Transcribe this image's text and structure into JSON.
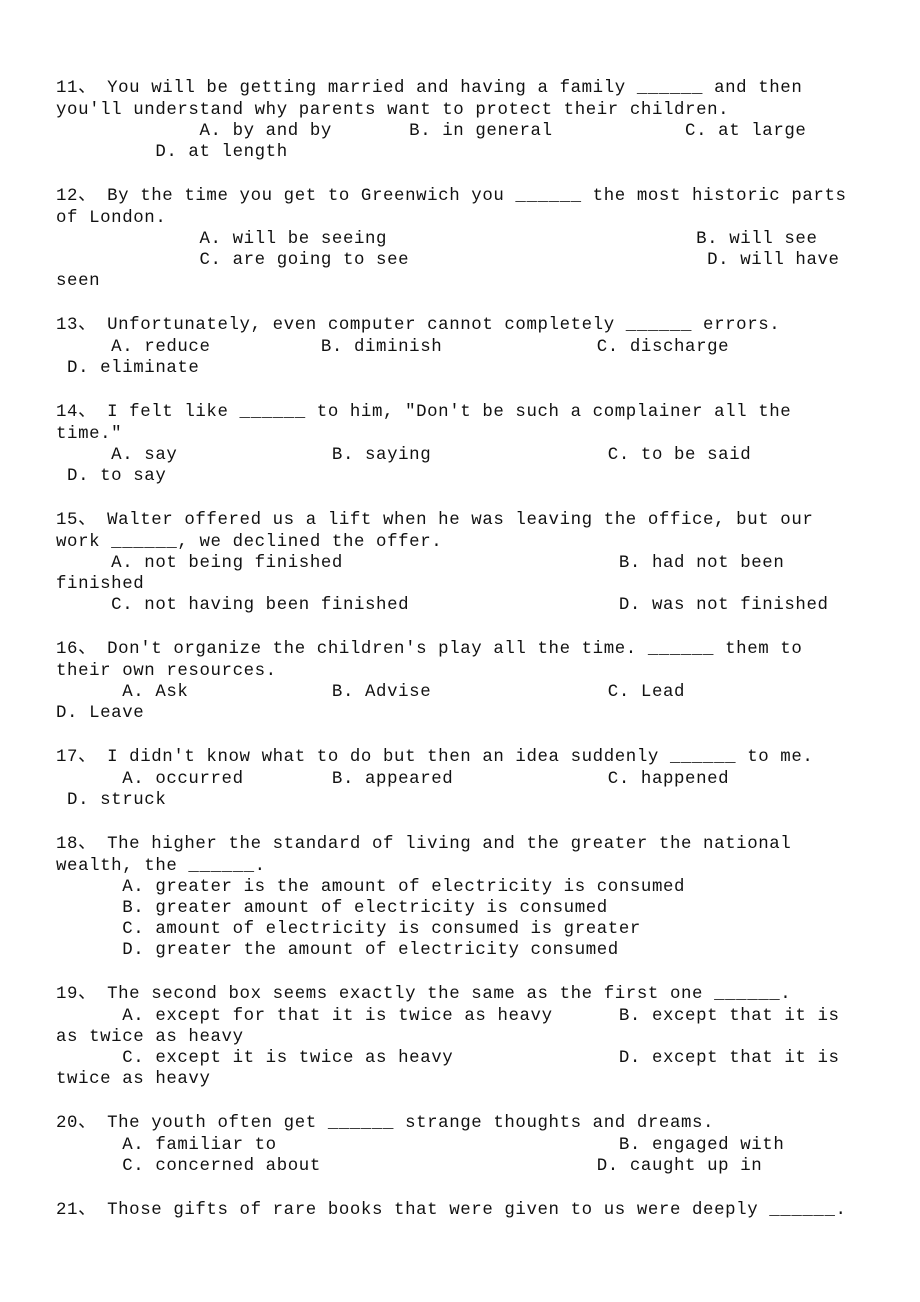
{
  "document": {
    "questions": [
      {
        "number": "11、",
        "stem_lines": [
          "11、 You will be getting married and having a family ______ and then",
          "you'll understand why parents want to protect their children."
        ],
        "option_lines": [
          "             A. by and by       B. in general            C. at large",
          "         D. at length"
        ],
        "options": {
          "A": "by and by",
          "B": "in general",
          "C": "at large",
          "D": "at length"
        }
      },
      {
        "number": "12、",
        "stem_lines": [
          "12、 By the time you get to Greenwich you ______ the most historic parts",
          "of London."
        ],
        "option_lines": [
          "             A. will be seeing                            B. will see",
          "             C. are going to see                           D. will have",
          "seen"
        ],
        "options": {
          "A": "will be seeing",
          "B": "will see",
          "C": "are going to see",
          "D": "will have seen"
        }
      },
      {
        "number": "13、",
        "stem_lines": [
          "13、 Unfortunately, even computer cannot completely ______ errors."
        ],
        "option_lines": [
          "     A. reduce          B. diminish              C. discharge",
          " D. eliminate"
        ],
        "options": {
          "A": "reduce",
          "B": "diminish",
          "C": "discharge",
          "D": "eliminate"
        }
      },
      {
        "number": "14、",
        "stem_lines": [
          "14、 I felt like ______ to him, \"Don't be such a complainer all the",
          "time.\""
        ],
        "option_lines": [
          "     A. say              B. saying                C. to be said",
          " D. to say"
        ],
        "options": {
          "A": "say",
          "B": "saying",
          "C": "to be said",
          "D": "to say"
        }
      },
      {
        "number": "15、",
        "stem_lines": [
          "15、 Walter offered us a lift when he was leaving the office, but our",
          "work ______, we declined the offer."
        ],
        "option_lines": [
          "     A. not being finished                         B. had not been",
          "finished",
          "     C. not having been finished                   D. was not finished"
        ],
        "options": {
          "A": "not being finished",
          "B": "had not been finished",
          "C": "not having been finished",
          "D": "was not finished"
        }
      },
      {
        "number": "16、",
        "stem_lines": [
          "16、 Don't organize the children's play all the time. ______ them to",
          "their own resources."
        ],
        "option_lines": [
          "      A. Ask             B. Advise                C. Lead",
          "D. Leave"
        ],
        "options": {
          "A": "Ask",
          "B": "Advise",
          "C": "Lead",
          "D": "Leave"
        }
      },
      {
        "number": "17、",
        "stem_lines": [
          "17、 I didn't know what to do but then an idea suddenly ______ to me."
        ],
        "option_lines": [
          "      A. occurred        B. appeared              C. happened",
          " D. struck"
        ],
        "options": {
          "A": "occurred",
          "B": "appeared",
          "C": "happened",
          "D": "struck"
        }
      },
      {
        "number": "18、",
        "stem_lines": [
          "18、 The higher the standard of living and the greater the national",
          "wealth, the ______."
        ],
        "option_lines": [
          "      A. greater is the amount of electricity is consumed",
          "      B. greater amount of electricity is consumed",
          "      C. amount of electricity is consumed is greater",
          "      D. greater the amount of electricity consumed"
        ],
        "options": {
          "A": "greater is the amount of electricity is consumed",
          "B": "greater amount of electricity is consumed",
          "C": "amount of electricity is consumed is greater",
          "D": "greater the amount of electricity consumed"
        }
      },
      {
        "number": "19、",
        "stem_lines": [
          "19、 The second box seems exactly the same as the first one ______."
        ],
        "option_lines": [
          "      A. except for that it is twice as heavy      B. except that it is",
          "as twice as heavy",
          "      C. except it is twice as heavy               D. except that it is",
          "twice as heavy"
        ],
        "options": {
          "A": "except for that it is twice as heavy",
          "B": "except that it is as twice as heavy",
          "C": "except it is twice as heavy",
          "D": "except that it is twice as heavy"
        }
      },
      {
        "number": "20、",
        "stem_lines": [
          "20、 The youth often get ______ strange thoughts and dreams."
        ],
        "option_lines": [
          "      A. familiar to                               B. engaged with",
          "      C. concerned about                         D. caught up in"
        ],
        "options": {
          "A": "familiar to",
          "B": "engaged with",
          "C": "concerned about",
          "D": "caught up in"
        }
      },
      {
        "number": "21、",
        "stem_lines": [
          "21、 Those gifts of rare books that were given to us were deeply ______."
        ],
        "option_lines": [],
        "options": {}
      }
    ]
  }
}
